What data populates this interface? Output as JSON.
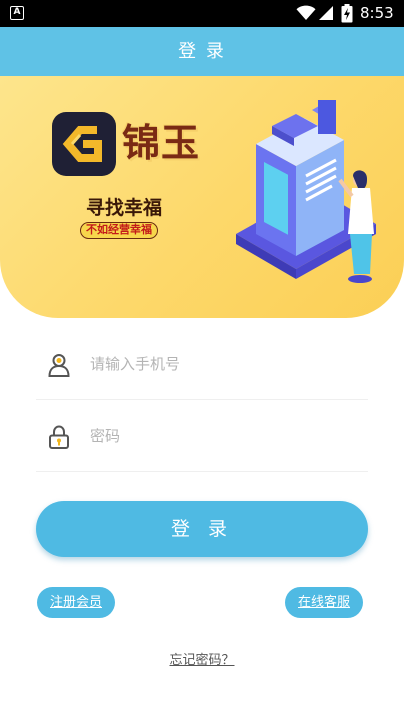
{
  "status_bar": {
    "time": "8:53",
    "icons": [
      "notification-a-icon",
      "wifi-icon",
      "signal-icon",
      "battery-charging-icon"
    ]
  },
  "header": {
    "title": "登 录",
    "background_color": "#5fc2e6"
  },
  "banner": {
    "brand_name": "锦玉",
    "slogan": "寻找幸福",
    "sub_slogan": "不如经营幸福",
    "icons": [
      "brand-logo-icon",
      "building-illustration-icon"
    ]
  },
  "form": {
    "phone": {
      "placeholder": "请输入手机号",
      "value": "",
      "icon": "user-icon"
    },
    "password": {
      "placeholder": "密码",
      "value": "",
      "icon": "lock-icon"
    },
    "login_label": "登 录"
  },
  "links": {
    "register_label": "注册会员",
    "service_label": "在线客服",
    "forgot_label": "忘记密码？"
  },
  "colors": {
    "accent": "#4fbae3",
    "banner_yellow": "#fdd86a"
  }
}
